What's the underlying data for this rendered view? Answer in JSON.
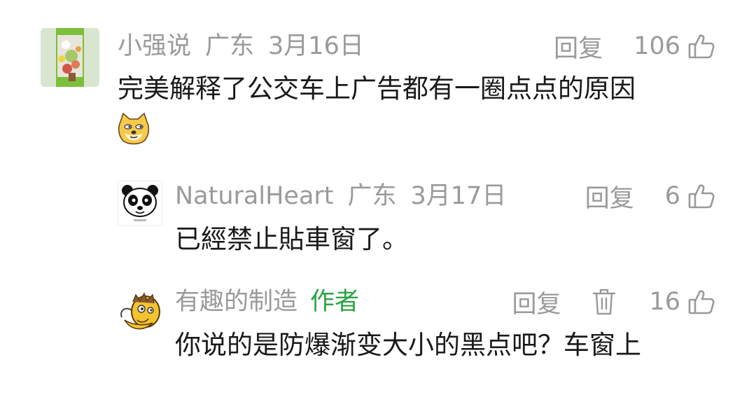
{
  "comments": [
    {
      "author": "小强说",
      "region": "广东",
      "date": "3月16日",
      "reply_label": "回复",
      "likes": "106",
      "text": "完美解释了公交车上广告都有一圈点点的原因",
      "has_emoji": true
    },
    {
      "author": "NaturalHeart",
      "region": "广东",
      "date": "3月17日",
      "reply_label": "回复",
      "likes": "6",
      "text": "已經禁止貼車窗了。"
    },
    {
      "author": "有趣的制造",
      "author_tag": "作者",
      "reply_label": "回复",
      "likes": "16",
      "text": "你说的是防爆渐变大小的黑点吧？车窗上"
    }
  ],
  "colors": {
    "meta_text": "#9a9a9a",
    "body_text": "#191919",
    "author_tag": "#2ba245",
    "background": "#ffffff"
  },
  "icons": {
    "like": "thumbs-up-icon",
    "delete": "trash-icon",
    "emoji": "doge-emoji-icon"
  }
}
